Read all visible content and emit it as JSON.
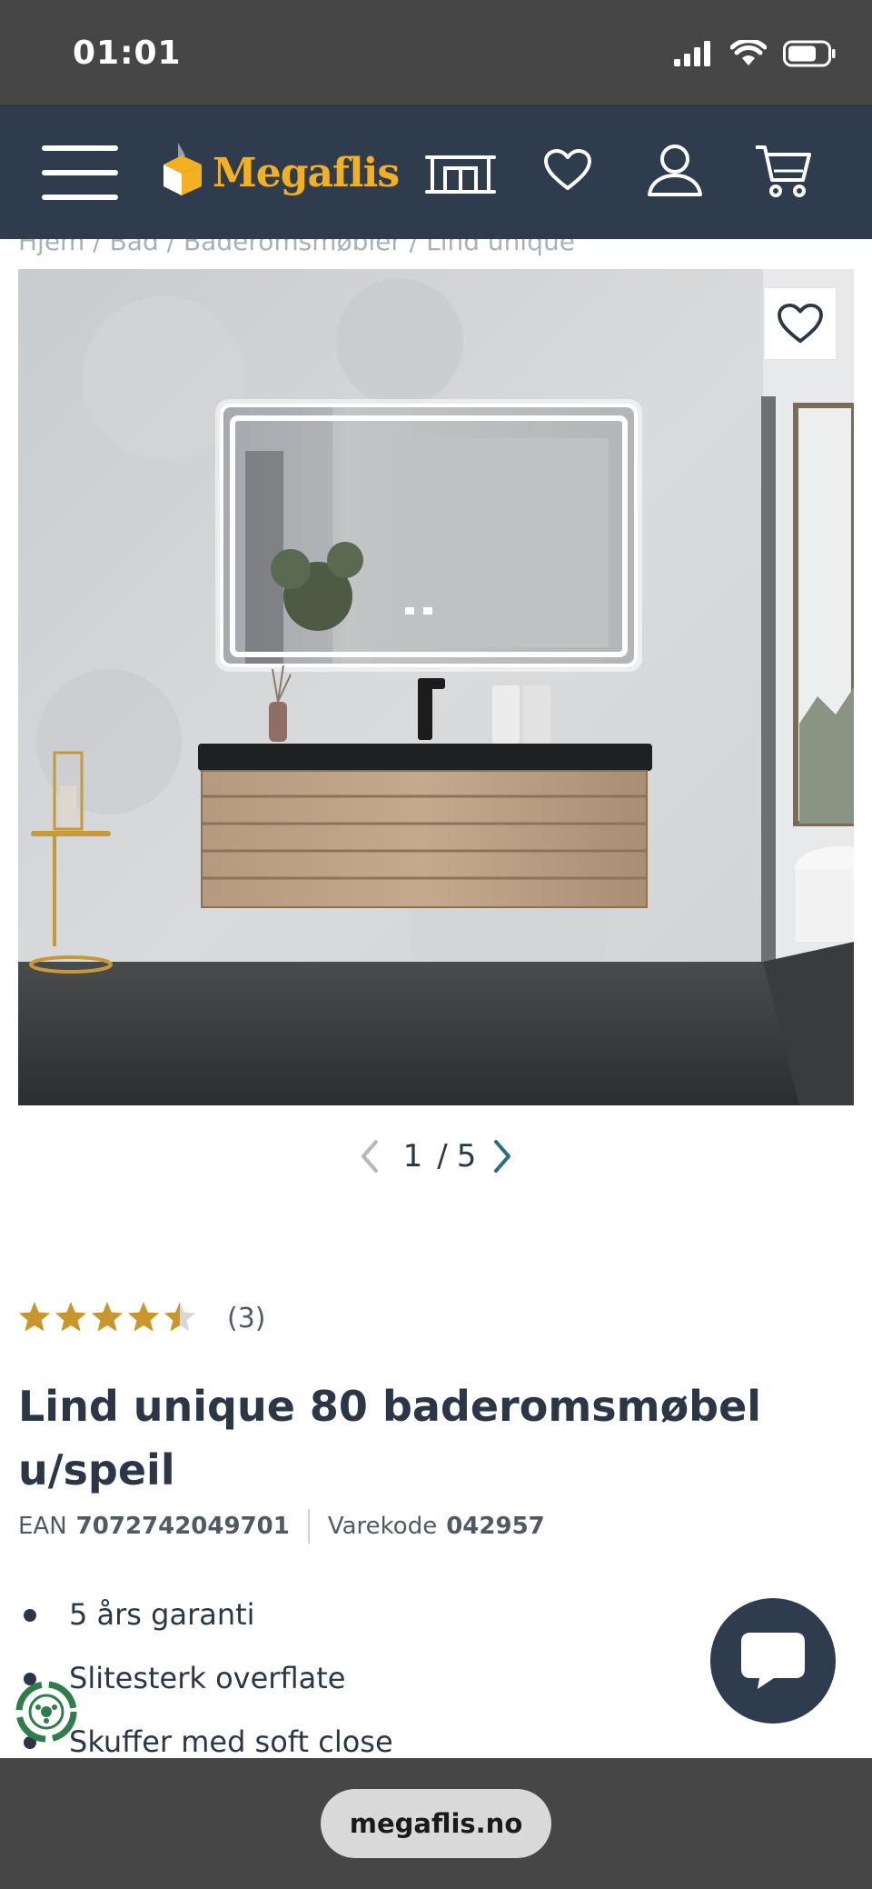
{
  "status_bar": {
    "time": "01:01"
  },
  "header": {
    "logo_text": "Megaflis",
    "icons": [
      "menu-icon",
      "showroom-icon",
      "heart-icon",
      "user-icon",
      "cart-icon"
    ]
  },
  "breadcrumb": {
    "text": "Hjem / Bad / Baderomsmøbler / Lind unique"
  },
  "gallery": {
    "current": "1",
    "separator": "/",
    "total": "5"
  },
  "product": {
    "rating_value": 4.5,
    "review_count": "(3)",
    "title": "Lind unique 80 baderomsmøbel u/speil",
    "ean_label": "EAN",
    "ean": "7072742049701",
    "code_label": "Varekode",
    "code": "042957",
    "features": [
      "5 års garanti",
      "Slitesterk overflate",
      "Skuffer med soft close"
    ]
  },
  "browser": {
    "url": "megaflis.no"
  },
  "colors": {
    "nav": "#2e3c4d",
    "brand_yellow": "#f3b021",
    "star": "#c9962a",
    "status_bar": "#464646"
  }
}
